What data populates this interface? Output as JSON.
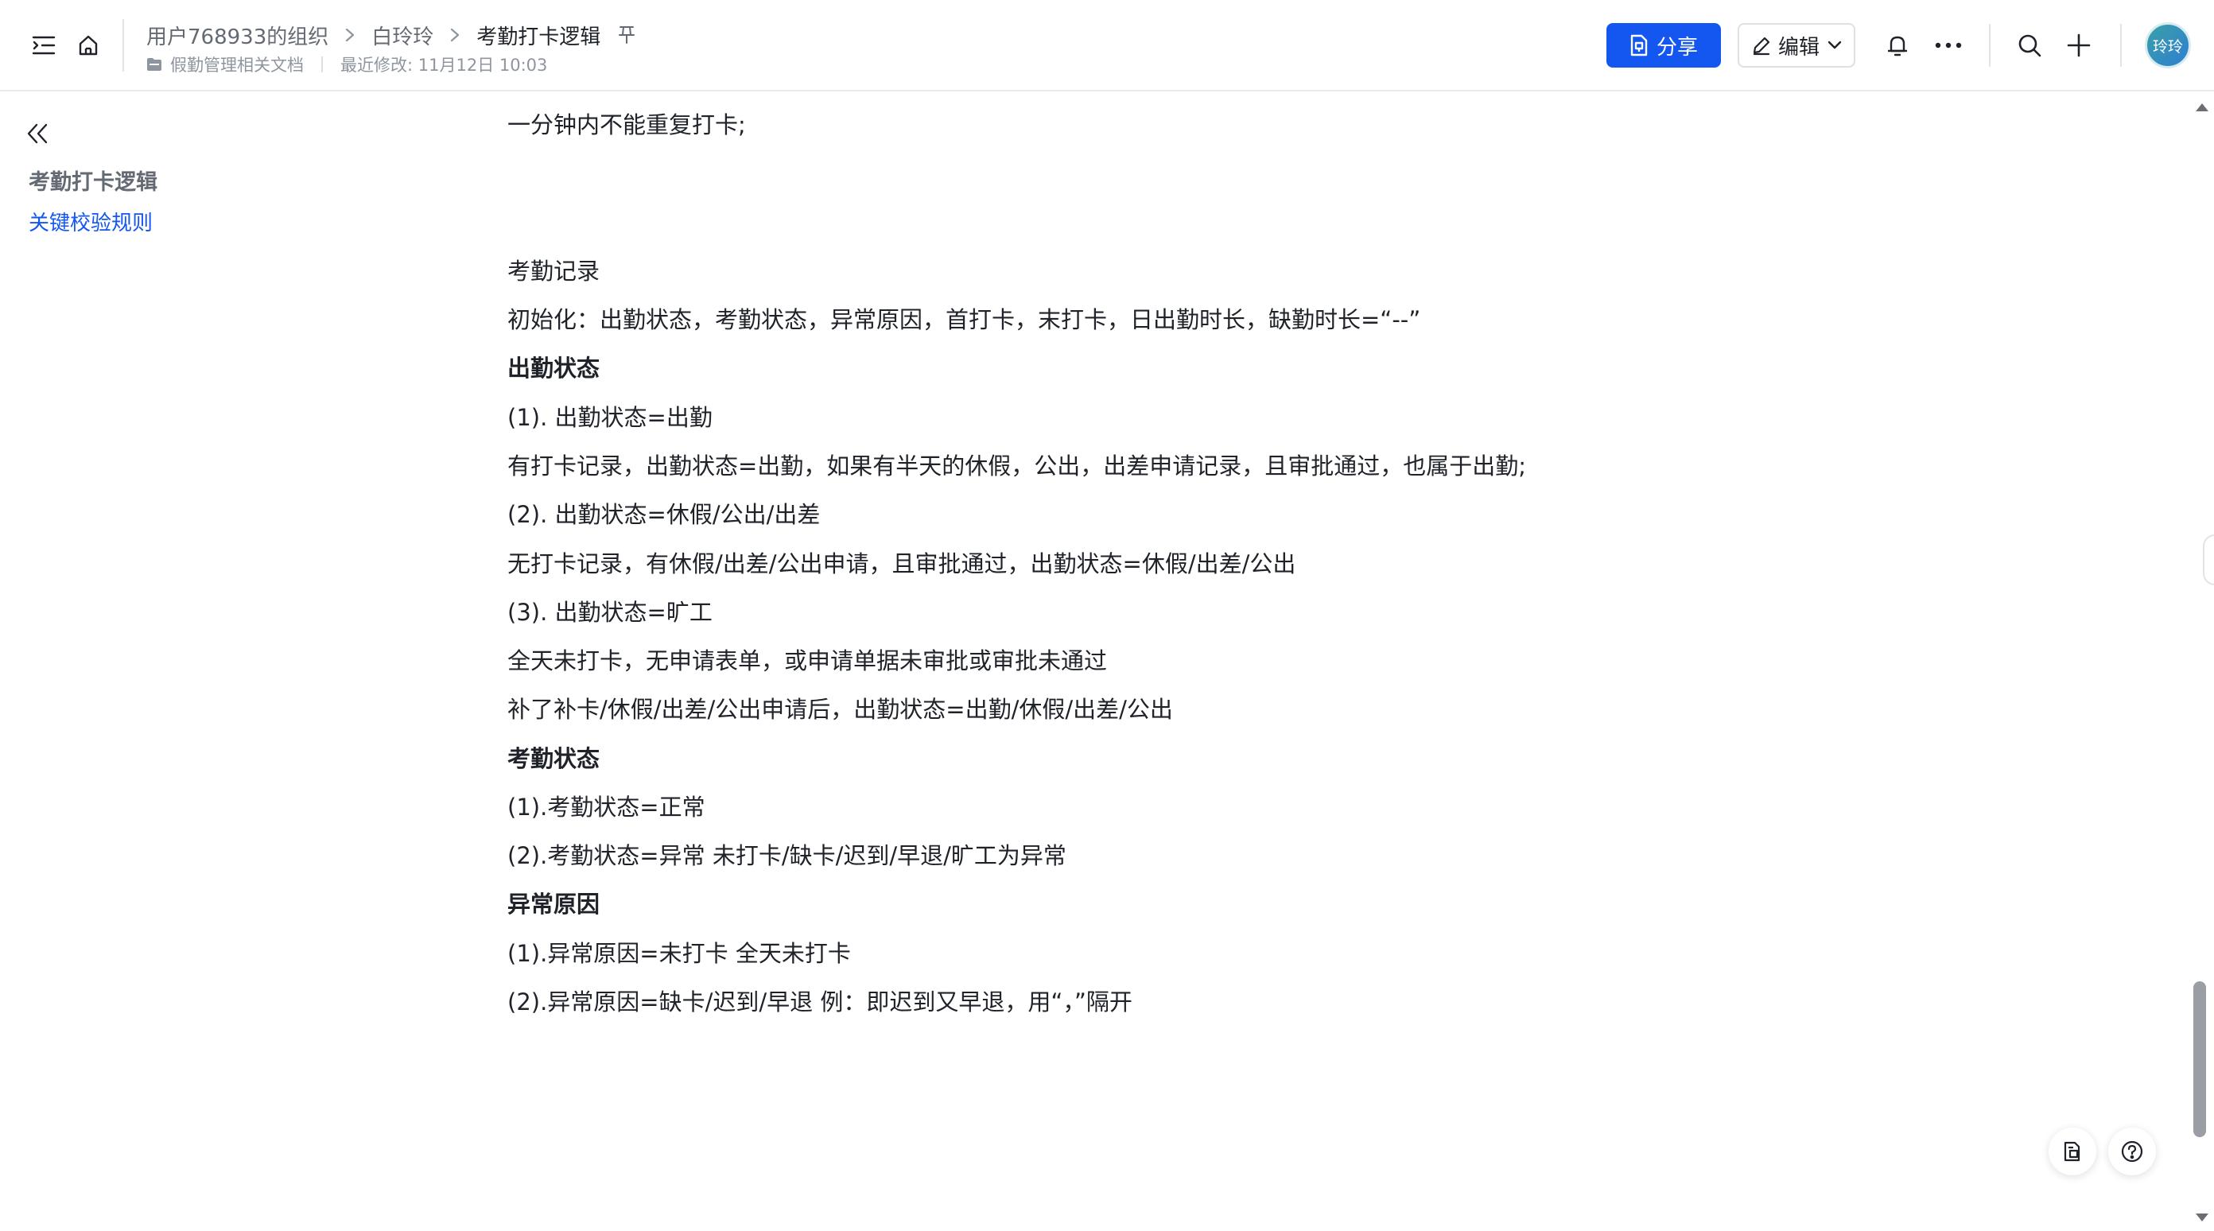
{
  "header": {
    "breadcrumbs": [
      "用户768933的组织",
      "白玲玲",
      "考勤打卡逻辑"
    ],
    "folder_name": "假勤管理相关文档",
    "last_modified": "最近修改: 11月12日 10:03",
    "share_label": "分享",
    "edit_label": "编辑",
    "avatar_text": "玲玲",
    "brand_color": "#1456f0"
  },
  "sidebar": {
    "outline_title": "考勤打卡逻辑",
    "outline_items": [
      {
        "label": "关键校验规则"
      }
    ]
  },
  "document": {
    "lines": [
      {
        "text": "一分钟内不能重复打卡;",
        "bold": false
      },
      {
        "text": "考勤记录",
        "bold": false
      },
      {
        "text": "初始化：出勤状态，考勤状态，异常原因，首打卡，末打卡，日出勤时长，缺勤时长=“--”",
        "bold": false
      },
      {
        "text": "出勤状态",
        "bold": true
      },
      {
        "text": "(1). 出勤状态=出勤",
        "bold": false
      },
      {
        "text": "有打卡记录，出勤状态=出勤，如果有半天的休假，公出，出差申请记录，且审批通过，也属于出勤;",
        "bold": false
      },
      {
        "text": "(2). 出勤状态=休假/公出/出差",
        "bold": false
      },
      {
        "text": "无打卡记录，有休假/出差/公出申请，且审批通过，出勤状态=休假/出差/公出",
        "bold": false
      },
      {
        "text": "(3). 出勤状态=旷工",
        "bold": false
      },
      {
        "text": "全天未打卡，无申请表单，或申请单据未审批或审批未通过",
        "bold": false
      },
      {
        "text": "补了补卡/休假/出差/公出申请后，出勤状态=出勤/休假/出差/公出",
        "bold": false
      },
      {
        "text": "考勤状态",
        "bold": true
      },
      {
        "text": "(1).考勤状态=正常",
        "bold": false
      },
      {
        "text": "(2).考勤状态=异常  未打卡/缺卡/迟到/早退/旷工为异常",
        "bold": false
      },
      {
        "text": "异常原因",
        "bold": true
      },
      {
        "text": "(1).异常原因=未打卡 全天未打卡",
        "bold": false
      },
      {
        "text": "(2).异常原因=缺卡/迟到/早退  例：即迟到又早退，用“，”隔开",
        "bold": false
      }
    ]
  },
  "icons": {
    "toc_toggle": "toc-toggle-icon",
    "home": "home-icon",
    "pin": "pin-icon",
    "folder": "folder-icon",
    "share": "share-doc-icon",
    "edit": "pencil-icon",
    "notification": "bell-icon",
    "more": "more-dots-icon",
    "search": "search-icon",
    "add": "plus-icon",
    "collapse": "double-chevron-left-icon",
    "float_1": "doc-outline-icon",
    "float_2": "help-icon"
  }
}
